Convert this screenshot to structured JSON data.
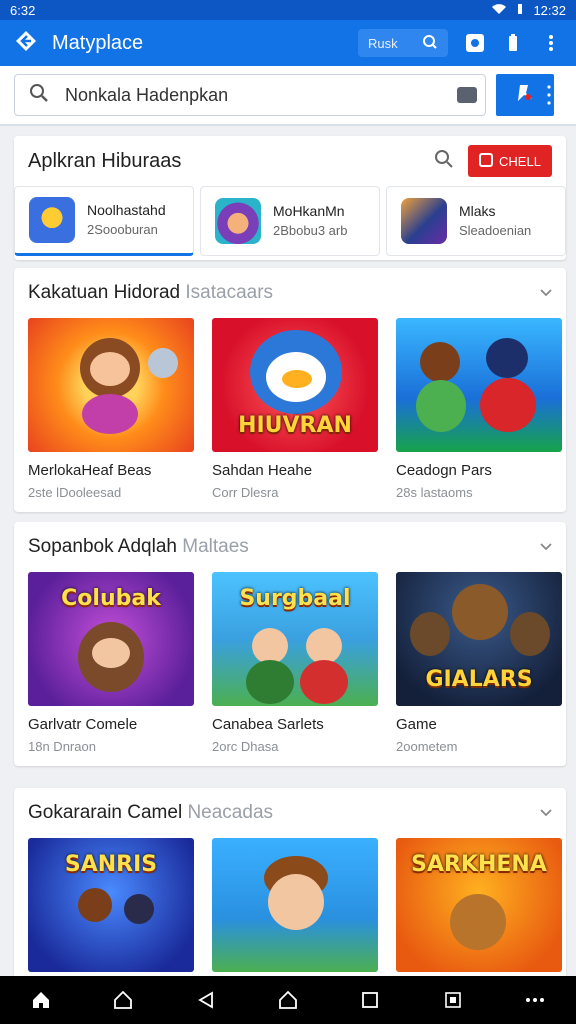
{
  "status": {
    "time": "6:32",
    "clock": "12:32"
  },
  "appbar": {
    "title": "Matyplace",
    "search_label": "Rusk"
  },
  "search": {
    "value": "Nonkala Hadenpkan"
  },
  "featured": {
    "title": "Aplkran Hiburaas",
    "button_label": "CHELL",
    "chips": [
      {
        "name": "Noolhastahd",
        "sub": "2Soooburan"
      },
      {
        "name": "MoHkanMn",
        "sub": "2Bbobu3 arb"
      },
      {
        "name": "Mlaks",
        "sub": "Sleadoenian"
      }
    ]
  },
  "sections": [
    {
      "title": "Kakatuan Hidorad",
      "title_faint": "Isatacaars",
      "games": [
        {
          "name": "MerlokaHeaf Beas",
          "sub": "2ste lDooleesad",
          "art_text": ""
        },
        {
          "name": "Sahdan Heahe",
          "sub": "Corr Dlesra",
          "art_text": "HIUVRAN"
        },
        {
          "name": "Ceadogn Pars",
          "sub": "28s lastaoms",
          "art_text": ""
        }
      ]
    },
    {
      "title": "Sopanbok Adqlah",
      "title_faint": "Maltaes",
      "games": [
        {
          "name": "Garlvatr Comele",
          "sub": "18n Dnraon",
          "art_text": "Colubak"
        },
        {
          "name": "Canabea Sarlets",
          "sub": "2orc Dhasa",
          "art_text": "Surgbaal"
        },
        {
          "name": "Game",
          "sub": "2oometem",
          "art_text": "GIALARS"
        }
      ]
    },
    {
      "title": "Gokararain Camel",
      "title_faint": "Neacadas",
      "games": [
        {
          "name": "",
          "sub": "",
          "art_text": "SANRIS"
        },
        {
          "name": "",
          "sub": "",
          "art_text": ""
        },
        {
          "name": "",
          "sub": "",
          "art_text": "SARKHENA"
        }
      ]
    }
  ],
  "colors": {
    "primary": "#1273e6",
    "accent_red": "#e02424",
    "statusbar": "#0d57c4"
  },
  "icons": {
    "appbar": [
      "back-icon",
      "search-icon",
      "camera-icon",
      "battery-icon",
      "more-vert-icon"
    ],
    "nav": [
      "home-icon",
      "home-outline-icon",
      "back-triangle-icon",
      "house-icon",
      "recents-icon",
      "screenshot-icon",
      "more-horiz-icon"
    ]
  }
}
